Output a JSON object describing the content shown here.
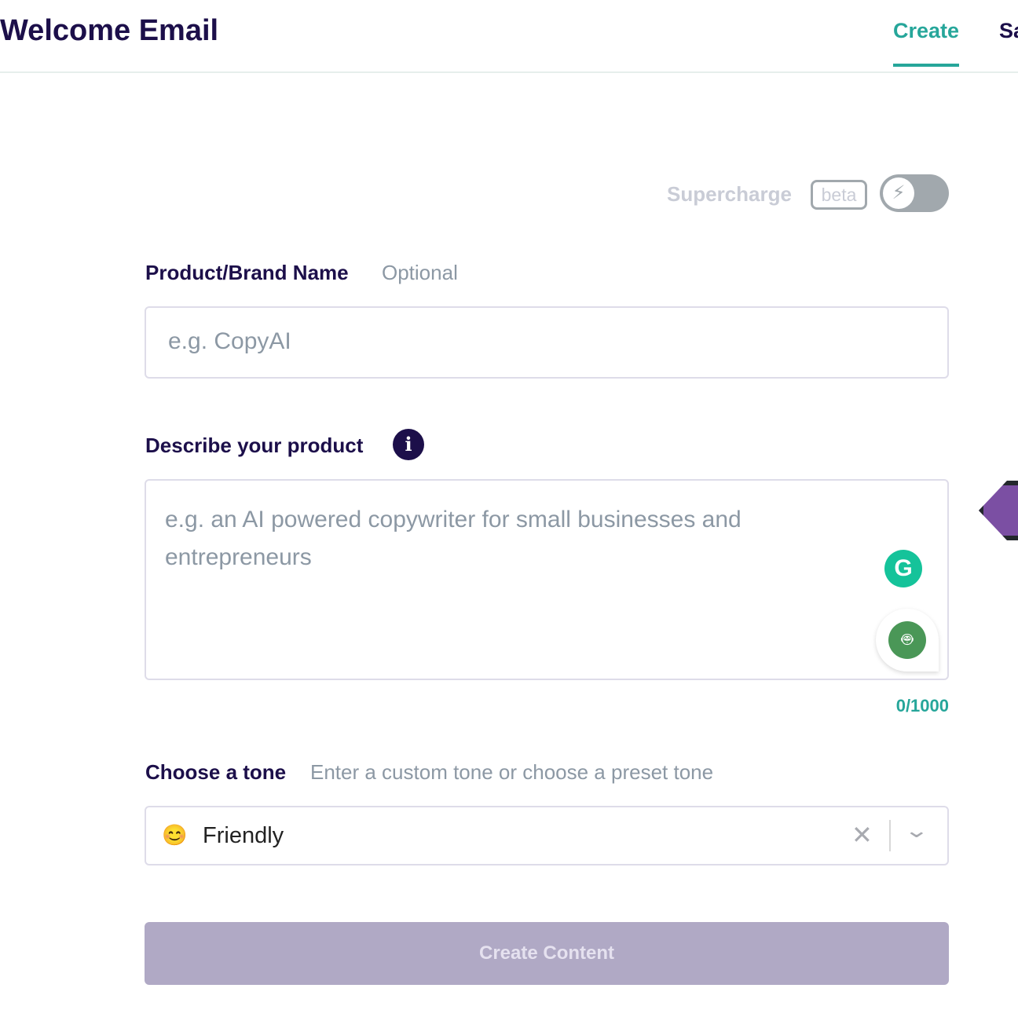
{
  "header": {
    "title": "Welcome Email",
    "tabs": [
      {
        "label": "Create",
        "active": true
      },
      {
        "label": "Sa"
      }
    ]
  },
  "supercharge": {
    "label": "Supercharge",
    "badge": "beta",
    "enabled": false,
    "icon": "lightning-icon"
  },
  "product_name": {
    "label": "Product/Brand Name",
    "hint": "Optional",
    "placeholder": "e.g. CopyAI",
    "value": ""
  },
  "description": {
    "label": "Describe your product",
    "info_icon": "i",
    "placeholder": "e.g. an AI powered copywriter for small businesses and entrepreneurs",
    "value": "",
    "counter": "0/1000"
  },
  "tone": {
    "label": "Choose a tone",
    "hint": "Enter a custom tone or choose a preset tone",
    "emoji": "😊",
    "value": "Friendly"
  },
  "submit": {
    "label": "Create Content"
  },
  "colors": {
    "accent": "#26a69a",
    "primary": "#1c0f4a",
    "button_disabled": "#b0a9c5"
  }
}
